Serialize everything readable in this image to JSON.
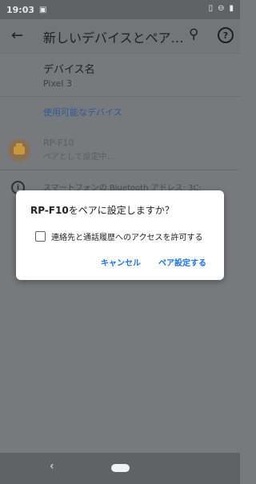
{
  "status_bar": {
    "time": "19:03",
    "notification_icon": "image-icon",
    "right_icons": [
      "vibrate-icon",
      "dnd-icon",
      "battery-icon"
    ]
  },
  "app_bar": {
    "title": "新しいデバイスとペア…",
    "back_icon": "arrow-back-icon",
    "search_icon": "search-icon",
    "help_icon": "help-icon"
  },
  "device_name": {
    "label": "デバイス名",
    "value": "Pixel 3"
  },
  "available_devices": {
    "header": "使用可能なデバイス",
    "items": [
      {
        "name": "RP-F10",
        "status": "ペアとして設定中…",
        "icon": "printer-icon"
      }
    ]
  },
  "info": {
    "text": "スマートフォンの Bluetooth アドレス: 3C:"
  },
  "dialog": {
    "title_bold": "RP-F10",
    "title_rest": "をペアに設定しますか？",
    "checkbox_label": "連絡先と通話履歴へのアクセスを許可する",
    "checkbox_checked": false,
    "cancel_label": "キャンセル",
    "confirm_label": "ペア設定する",
    "accent_color": "#1a73e8"
  },
  "nav_bar": {
    "back": "‹"
  }
}
